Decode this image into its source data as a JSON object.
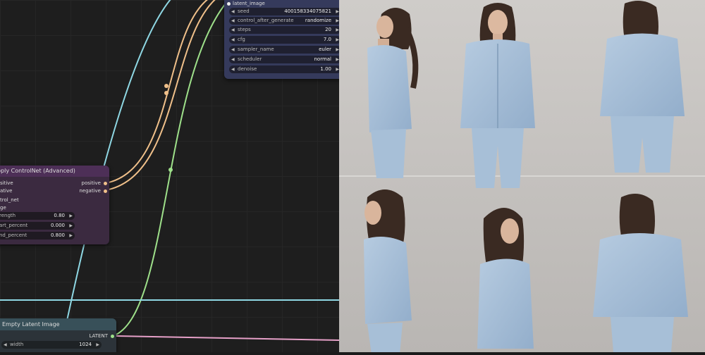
{
  "ksampler": {
    "latent_slot": "latent_image",
    "rows": [
      {
        "label": "seed",
        "value": "400158334075821"
      },
      {
        "label": "control_after_generate",
        "value": "randomize"
      },
      {
        "label": "steps",
        "value": "20"
      },
      {
        "label": "cfg",
        "value": "7.0"
      },
      {
        "label": "sampler_name",
        "value": "euler"
      },
      {
        "label": "scheduler",
        "value": "normal"
      },
      {
        "label": "denoise",
        "value": "1.00"
      }
    ]
  },
  "controlnet": {
    "title": "pply ControlNet (Advanced)",
    "inputs": [
      "sitive",
      "ative",
      "trol_net",
      "ge"
    ],
    "outputs": [
      "positive",
      "negative"
    ],
    "rows": [
      {
        "label": "rength",
        "value": "0.80"
      },
      {
        "label": "art_percent",
        "value": "0.000"
      },
      {
        "label": "nd_percent",
        "value": "0.800"
      }
    ]
  },
  "empty_latent": {
    "title": "Empty Latent Image",
    "output": "LATENT",
    "rows": [
      {
        "label": "width",
        "value": "1024"
      }
    ]
  },
  "colors": {
    "wire_cyan": "#8fd8e4",
    "wire_orange": "#f0c08a",
    "wire_green": "#9ee08a",
    "wire_pink": "#e6a0c8",
    "photo_background": "#c7c4c1",
    "denim": "#a9c2db"
  }
}
